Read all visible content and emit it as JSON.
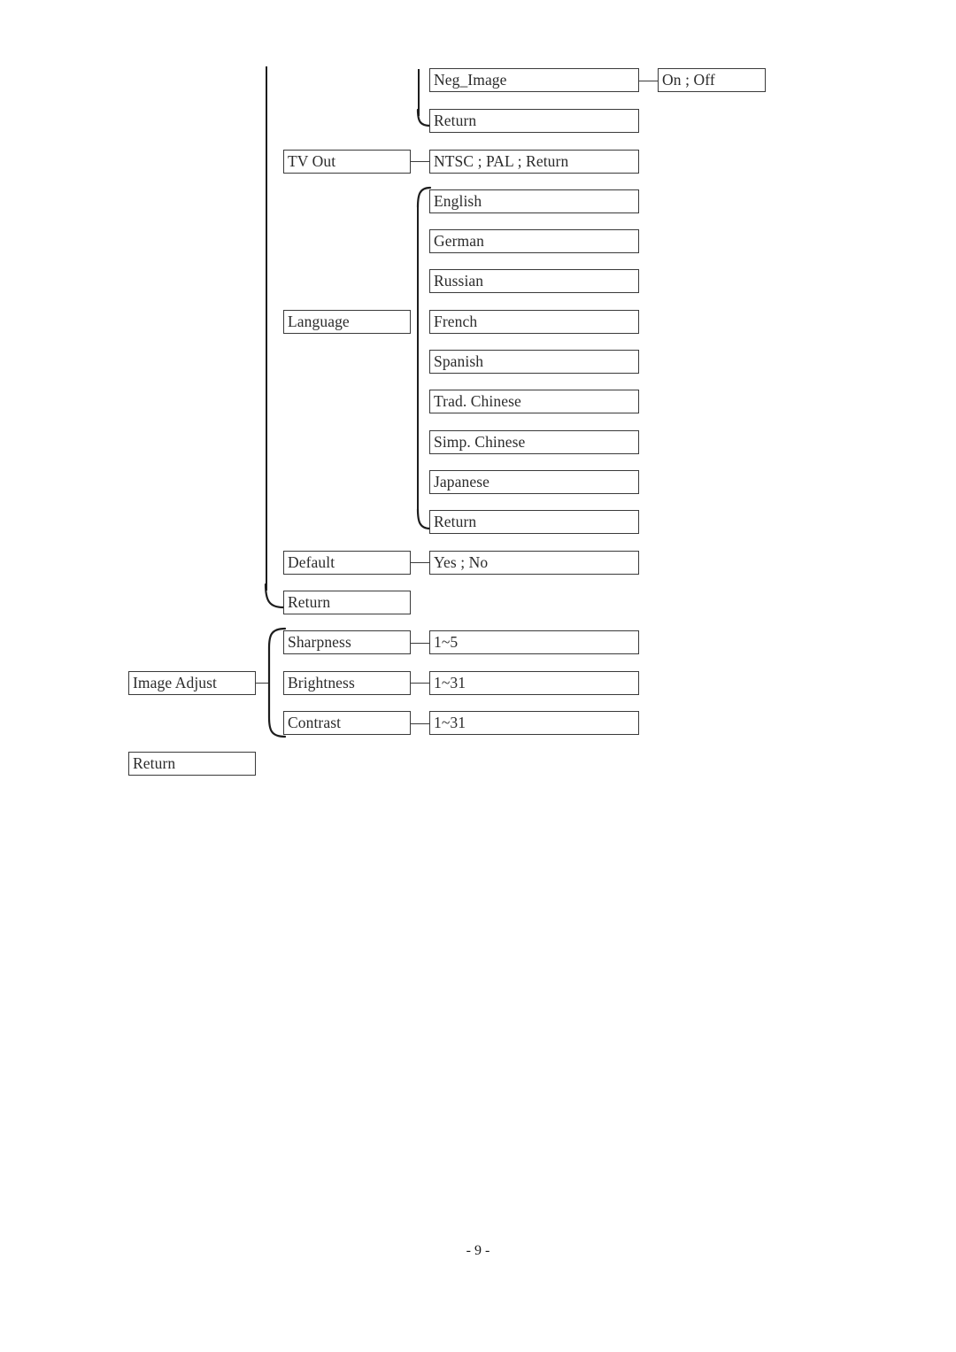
{
  "document": {
    "type": "menu-tree-diagram",
    "page_number": "- 9 -"
  },
  "nodes": {
    "neg_image": "Neg_Image",
    "neg_image_value": "On ; Off",
    "settings_return": "Return",
    "tv_out": "TV Out",
    "tv_out_value": "NTSC ; PAL ; Return",
    "language": "Language",
    "default": "Default",
    "default_value": "Yes ; No",
    "menu_return": "Return",
    "image_adjust": "Image Adjust",
    "sharpness": "Sharpness",
    "sharpness_value": "1~5",
    "brightness": "Brightness",
    "brightness_value": "1~31",
    "contrast": "Contrast",
    "contrast_value": "1~31",
    "root_return": "Return"
  },
  "language_options": [
    {
      "label": "English"
    },
    {
      "label": "German"
    },
    {
      "label": "Russian"
    },
    {
      "label": "French"
    },
    {
      "label": "Spanish"
    },
    {
      "label": "Trad. Chinese"
    },
    {
      "label": "Simp. Chinese"
    },
    {
      "label": "Japanese"
    },
    {
      "label": "Return"
    }
  ],
  "colors": {
    "box_border": "#3a3a3a",
    "connector": "#1d1d1d",
    "text": "#2b2b2b",
    "background": "#ffffff"
  }
}
